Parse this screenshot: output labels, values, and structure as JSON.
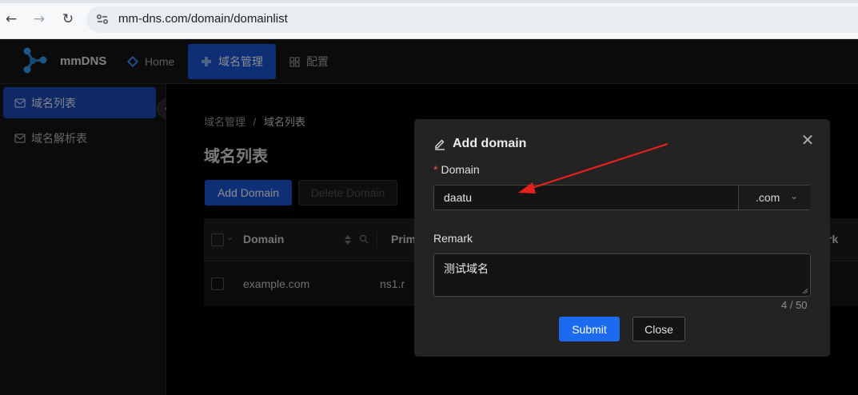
{
  "browser": {
    "url": "mm-dns.com/domain/domainlist",
    "back_icon": "←",
    "forward_icon": "→",
    "reload_icon": "↻"
  },
  "app": {
    "brand": "mmDNS",
    "menu": [
      {
        "label": "Home",
        "icon": "home-diamond-icon"
      },
      {
        "label": "域名管理",
        "icon": "puzzle-icon",
        "active": true
      },
      {
        "label": "配置",
        "icon": "grid-icon"
      }
    ],
    "accent_color": "#1b55d8"
  },
  "sidebar": {
    "items": [
      {
        "label": "域名列表",
        "icon": "mail-icon",
        "active": true
      },
      {
        "label": "域名解析表",
        "icon": "mail-icon"
      }
    ],
    "collapse_icon": "‹"
  },
  "main": {
    "breadcrumb": {
      "root": "域名管理",
      "sep": "/",
      "current": "域名列表"
    },
    "title": "域名列表",
    "add_button": "Add Domain",
    "delete_button": "Delete Domain",
    "table": {
      "columns": [
        "Domain",
        "Prim",
        "rk"
      ],
      "rows": [
        {
          "domain": "example.com",
          "primary": "ns1.r"
        }
      ]
    }
  },
  "modal": {
    "title": "Add domain",
    "close_icon": "✕",
    "domain_label": "Domain",
    "domain_required_mark": "*",
    "domain_value": "daatu",
    "suffix_value": ".com",
    "suffix_chevron": "⌄",
    "remark_label": "Remark",
    "remark_value": "测试域名",
    "remark_counter": "4 / 50",
    "submit": "Submit",
    "close": "Close",
    "annotation_arrow_color": "#e8201c"
  }
}
